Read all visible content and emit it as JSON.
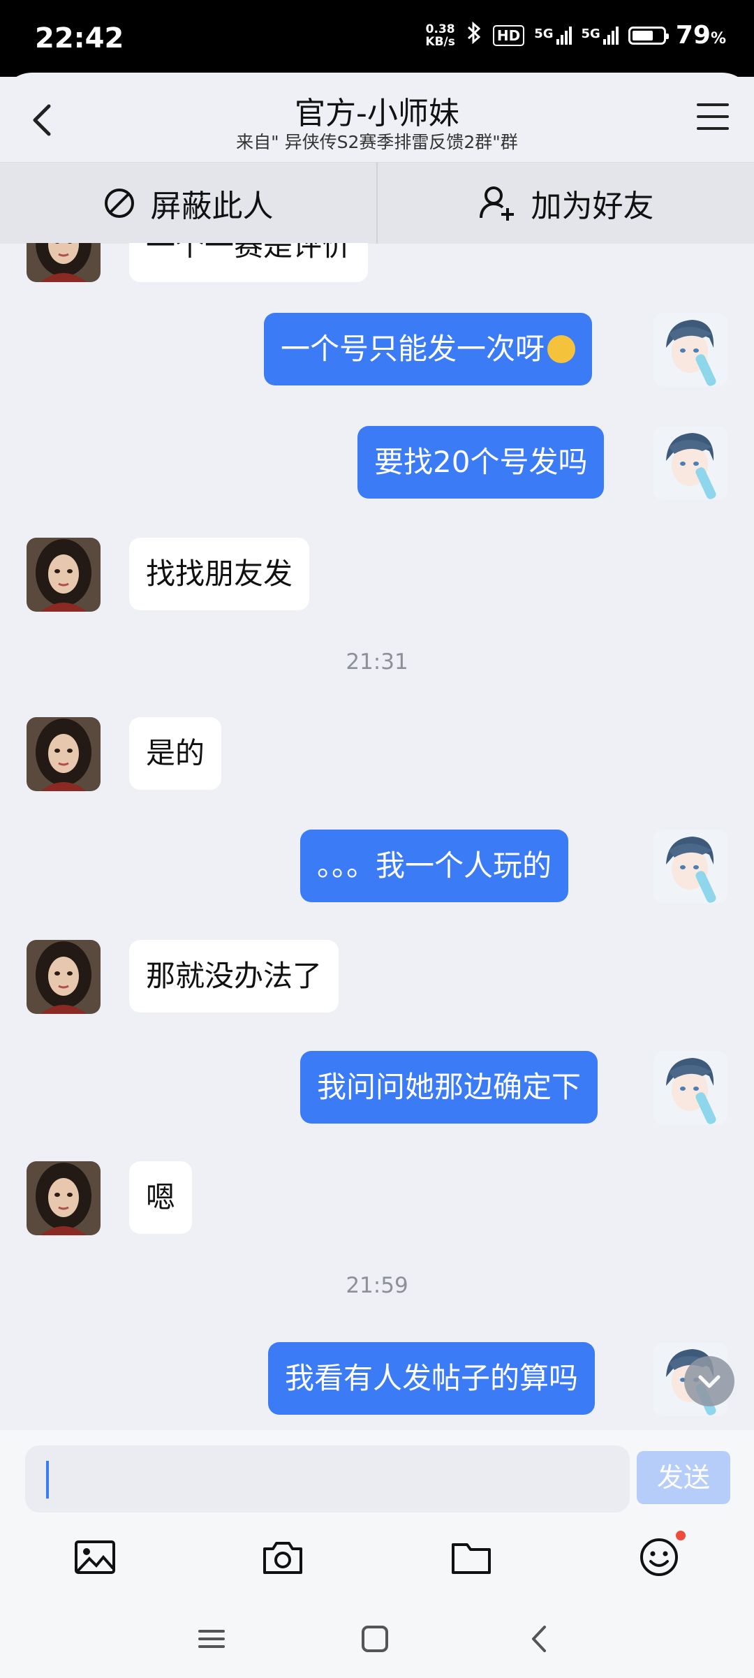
{
  "status_bar": {
    "time": "22:42",
    "net_speed": "0.38",
    "net_unit": "KB/s",
    "hd": "HD",
    "sig1": "5G",
    "sig2": "5G",
    "battery_percent": 79,
    "battery_text": "79",
    "battery_symbol": "%"
  },
  "header": {
    "title": "官方-小师妹",
    "subtitle": "来自\" 异侠传S2赛季排雷反馈2群\"群"
  },
  "actions": {
    "block": "屏蔽此人",
    "add_friend": "加为好友"
  },
  "messages": [
    {
      "type": "in",
      "text": "一个一赛是评价"
    },
    {
      "type": "out",
      "text": "一个号只能发一次呀",
      "emoji": "laughing-tears"
    },
    {
      "type": "out",
      "text": "要找20个号发吗"
    },
    {
      "type": "in",
      "text": "找找朋友发"
    },
    {
      "type": "time",
      "text": "21:31"
    },
    {
      "type": "in",
      "text": "是的"
    },
    {
      "type": "out",
      "text": "。。。我一个人玩的"
    },
    {
      "type": "in",
      "text": "那就没办法了"
    },
    {
      "type": "out",
      "text": "我问问她那边确定下"
    },
    {
      "type": "in",
      "text": "嗯"
    },
    {
      "type": "time",
      "text": "21:59"
    },
    {
      "type": "out",
      "text": "我看有人发帖子的算吗"
    }
  ],
  "composer": {
    "input_value": "",
    "send_label": "发送"
  },
  "icons": {
    "back": "chevron-left-icon",
    "menu": "menu-icon",
    "block": "block-icon",
    "add_friend": "add-user-icon",
    "image": "image-icon",
    "camera": "camera-icon",
    "folder": "folder-icon",
    "emoji": "emoji-icon",
    "scroll_down": "chevron-down-icon"
  },
  "colors": {
    "outgoing_bubble": "#3b7cf6",
    "incoming_bubble": "#ffffff",
    "background": "#eef0f5",
    "send_disabled": "#b5cdf8",
    "notification_dot": "#f04b3b"
  }
}
